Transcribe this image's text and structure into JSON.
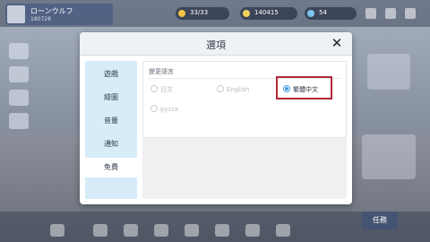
{
  "hud": {
    "player_name": "ローンウルフ",
    "player_sub": "180728",
    "resource_1": "33/33",
    "resource_2": "140415",
    "resource_3": "54"
  },
  "dialog": {
    "title": "選項",
    "close_glyph": "✕",
    "tabs": [
      {
        "label": "遊戲"
      },
      {
        "label": "繪圖"
      },
      {
        "label": "音量"
      },
      {
        "label": "通知"
      },
      {
        "label": "免費"
      }
    ],
    "active_tab": "免費",
    "section_label": "變更語言",
    "languages": [
      {
        "label": "日文",
        "selected": false
      },
      {
        "label": "English",
        "selected": false
      },
      {
        "label": "繁體中文",
        "selected": true
      },
      {
        "label": "русск",
        "selected": false
      }
    ]
  },
  "bottom_bar": {
    "items": [
      "",
      "",
      "",
      "",
      "",
      "",
      "",
      ""
    ],
    "action_label": "任務"
  },
  "colors": {
    "sidebar_bg": "#d7ecf8",
    "radio_selected": "#4a9ee0",
    "highlight_box": "#b0283a"
  }
}
